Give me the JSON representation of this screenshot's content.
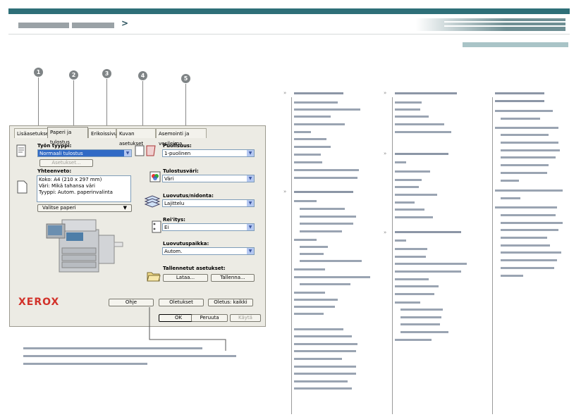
{
  "dialog": {
    "tabs": [
      "Lisäasetukset",
      "Paperi ja tulostus",
      "Erikoissivut",
      "Kuvan asetukset",
      "Asemointi ja vesileima"
    ],
    "active_tab": "Paperi ja tulostus",
    "job_type": {
      "label": "Työn tyyppi:",
      "value": "Normaali tulostus",
      "settings_button": "Asetukset..."
    },
    "summary": {
      "label": "Yhteenveto:",
      "lines": [
        "Koko: A4 (210 x 297 mm)",
        "Väri: Mikä tahansa väri",
        "Tyyppi: Autom. paperinvalinta"
      ]
    },
    "paper_button": "Valitse paperi",
    "sides": {
      "label": "Puolisuus:",
      "value": "1-puolinen"
    },
    "color": {
      "label": "Tulostusväri:",
      "value": "Väri"
    },
    "finishing": {
      "label": "Luovutus/nidonta:",
      "value": "Lajittelu"
    },
    "punch": {
      "label": "Rei'itys:",
      "value": "Ei"
    },
    "output": {
      "label": "Luovutuspaikka:",
      "value": "Autom."
    },
    "saved": {
      "label": "Tallennetut asetukset:",
      "load": "Lataa...",
      "save": "Tallenna..."
    },
    "buttons": {
      "help": "Ohje",
      "defaults": "Oletukset",
      "defaults_all": "Oletus: kaikki",
      "ok": "OK",
      "cancel": "Peruuta",
      "apply": "Käytä"
    },
    "logo": "XEROX"
  },
  "callouts": [
    "1",
    "2",
    "3",
    "4",
    "5"
  ],
  "colors": {
    "accent": "#2e6f78",
    "tab_bg": "#ecebe4",
    "select_highlight": "#316ac5",
    "logo": "#d2322a"
  }
}
